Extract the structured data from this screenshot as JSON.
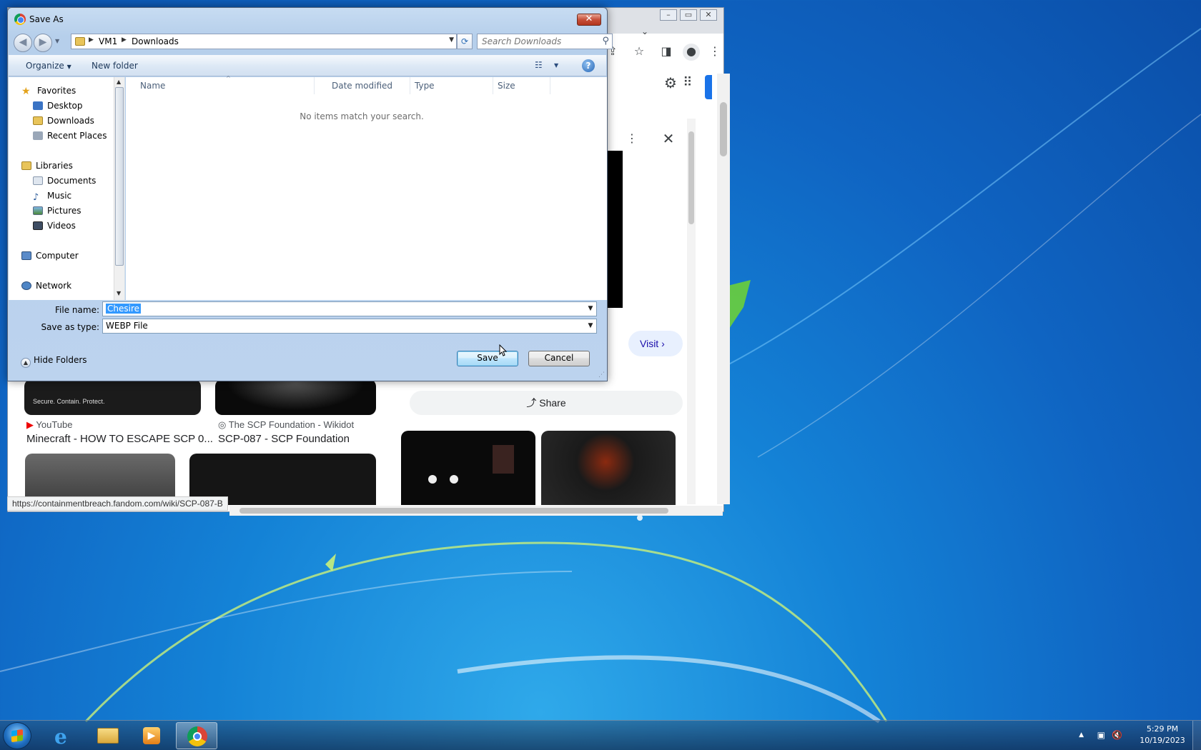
{
  "dialog": {
    "title": "Save As",
    "breadcrumb": [
      "VM1",
      "Downloads"
    ],
    "search_placeholder": "Search Downloads",
    "toolbar": {
      "organize": "Organize",
      "new_folder": "New folder"
    },
    "nav": {
      "favorites": "Favorites",
      "favorites_items": [
        "Desktop",
        "Downloads",
        "Recent Places"
      ],
      "libraries": "Libraries",
      "libraries_items": [
        "Documents",
        "Music",
        "Pictures",
        "Videos"
      ],
      "computer": "Computer",
      "network": "Network"
    },
    "columns": [
      "Name",
      "Date modified",
      "Type",
      "Size"
    ],
    "empty_message": "No items match your search.",
    "file_name_label": "File name:",
    "file_name_value": "Chesire",
    "save_type_label": "Save as type:",
    "save_type_value": "WEBP File",
    "hide_folders": "Hide Folders",
    "save_button": "Save",
    "cancel_button": "Cancel"
  },
  "browser": {
    "results": [
      {
        "source": "YouTube",
        "title": "Minecraft - HOW TO ESCAPE SCP 0..."
      },
      {
        "source": "The SCP Foundation - Wikidot",
        "title": "SCP-087 - SCP Foundation"
      }
    ],
    "thumb_caption": "Secure. Contain. Protect.",
    "visit_button": "Visit",
    "share_button": "Share",
    "status_url": "https://containmentbreach.fandom.com/wiki/SCP-087-B"
  },
  "taskbar": {
    "time": "5:29 PM",
    "date": "10/19/2023"
  },
  "colors": {
    "dialog_frame": "#b6cfeb",
    "selection": "#3399ff",
    "desktop": "#1482d6",
    "close_button": "#c7503a"
  }
}
